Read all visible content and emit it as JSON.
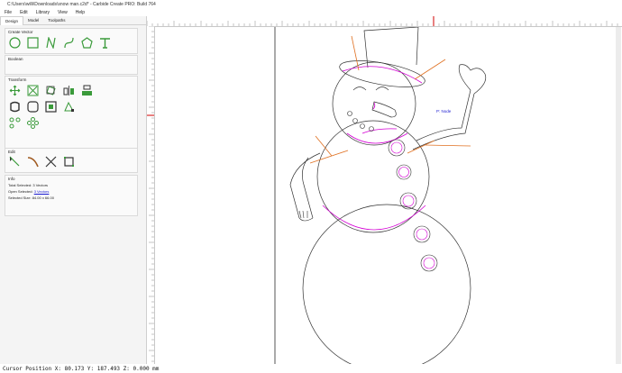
{
  "window": {
    "title": "C:\\Users\\willi\\Downloads\\snow man.c2d* - Carbide Create PRO: Build 764"
  },
  "menu": {
    "items": [
      "File",
      "Edit",
      "Library",
      "View",
      "Help"
    ]
  },
  "tabs": [
    "Design",
    "Model",
    "Toolpaths"
  ],
  "sections": {
    "create_vector": "Create Vector",
    "boolean": "Boolean",
    "transform": "Transform",
    "edit": "Edit",
    "info": "Info"
  },
  "info": {
    "total_selected_label": "Total Selected:",
    "total_selected_value": "3 Vectors",
    "open_selected_label": "Open Selected:",
    "open_selected_value": "3 Vectors",
    "selected_size_label": "Selected Size:",
    "selected_size_value": "84.00 x 66.00"
  },
  "canvas": {
    "mode_label": "P: Node"
  },
  "status": {
    "cursor_position": "Cursor Position X: 80.173 Y: 187.493 Z: 0.000 mm"
  },
  "colors": {
    "accent_green": "#3a9a3a",
    "selection_magenta": "#d400d4",
    "carrot_orange": "#e07020",
    "ruler_marker_red": "#d00000",
    "node_blue": "#1a1ad0"
  }
}
